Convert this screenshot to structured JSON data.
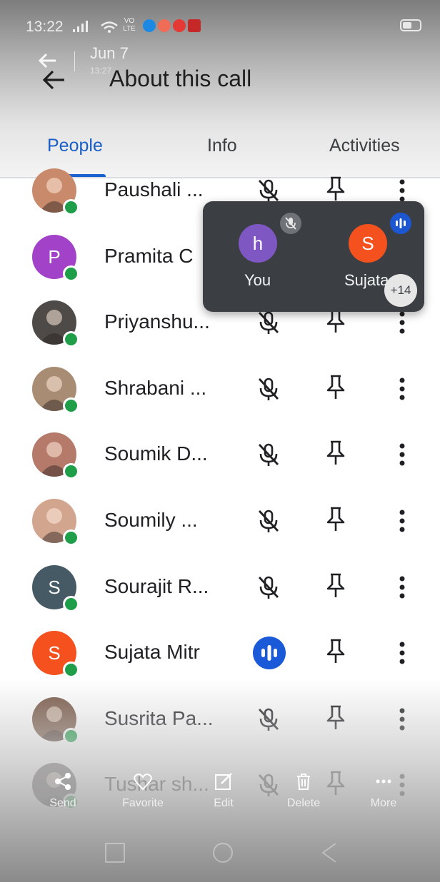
{
  "status_bar": {
    "time": "13:22",
    "volte": "VO LTE"
  },
  "overlay": {
    "date": "Jun 7",
    "sub": "13:27"
  },
  "header": {
    "title": "About this call"
  },
  "tabs": [
    {
      "label": "People",
      "active": true
    },
    {
      "label": "Info",
      "active": false
    },
    {
      "label": "Activities",
      "active": false
    }
  ],
  "participants": [
    {
      "name": "Paushali ...",
      "avatar": "photo",
      "mic": "muted"
    },
    {
      "name": "Pramita C",
      "avatar": "P",
      "avatar_color": "#a142c9",
      "mic": "muted"
    },
    {
      "name": "Priyanshu...",
      "avatar": "photo",
      "mic": "muted"
    },
    {
      "name": "Shrabani ...",
      "avatar": "photo",
      "mic": "muted"
    },
    {
      "name": "Soumik D...",
      "avatar": "photo",
      "mic": "muted"
    },
    {
      "name": "Soumily ...",
      "avatar": "photo",
      "mic": "muted"
    },
    {
      "name": "Sourajit R...",
      "avatar": "S",
      "avatar_color": "#455a64",
      "mic": "muted"
    },
    {
      "name": "Sujata Mitr",
      "avatar": "S",
      "avatar_color": "#f4511e",
      "mic": "speaking"
    },
    {
      "name": "Susrita Pa...",
      "avatar": "photo",
      "mic": "muted"
    },
    {
      "name": "Tushar sh...",
      "avatar": "photo",
      "mic": "muted"
    }
  ],
  "popup": {
    "you_initial": "h",
    "you_label": "You",
    "sujata_initial": "S",
    "sujata_label": "Sujata",
    "more_count": "+14"
  },
  "gallery_actions": [
    {
      "label": "Send",
      "icon": "share-icon"
    },
    {
      "label": "Favorite",
      "icon": "heart-icon"
    },
    {
      "label": "Edit",
      "icon": "edit-icon"
    },
    {
      "label": "Delete",
      "icon": "trash-icon"
    },
    {
      "label": "More",
      "icon": "more-horizontal-icon"
    }
  ],
  "colors": {
    "accent": "#1a5ec8",
    "online": "#1e9e49",
    "speaking": "#1a5ad9",
    "popup_bg": "#3b3f43"
  }
}
